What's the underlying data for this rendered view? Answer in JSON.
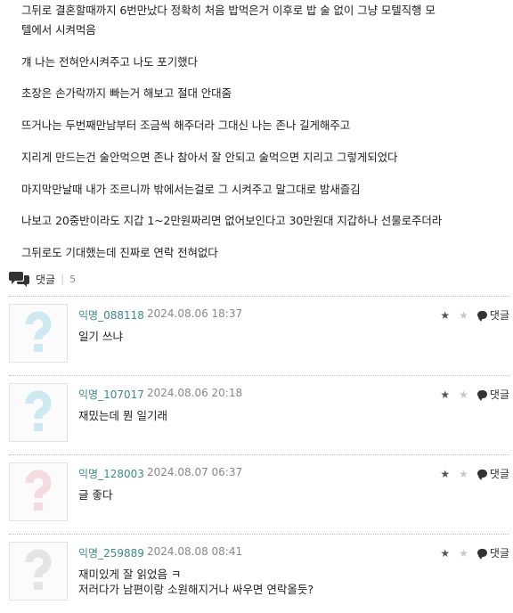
{
  "post": {
    "lines": [
      "그뒤로 결혼할때까지 6번만났다 정확히 처음 밥먹은거 이후로 밥 술 없이 그냥 모텔직행 모",
      "텔에서 시켜먹음",
      "걔 나는 전혀안시켜주고 나도 포기했다",
      "초장은 손가락까지 빠는거 해보고 절대 안대줌",
      "뜨거나는 두번째만남부터 조금씩 해주더라 그대신 나는 존나 길게해주고",
      "지리게 만드는건 술안먹으면 존나 참아서 잘 안되고 술먹으면 지리고 그렇게되었다",
      "마지막만날때 내가 조르니까 밖에서는걸로 그 시켜주고 말그대로 밤새즐김",
      "나보고 20중반이라도 지갑 1~2만원짜리면 없어보인다고 30만원대 지갑하나 선물로주더라",
      "그뒤로도 기대했는데 진짜로 연락 전혀없다"
    ]
  },
  "comment_bar": {
    "icon": "speech-bubbles-icon",
    "label": "댓글",
    "count": "5"
  },
  "comments": [
    {
      "author": "익명_088118",
      "date": "2024.08.06 18:37",
      "text_lines": [
        "일기 쓰냐"
      ],
      "avatar_color": "#cfe9f2",
      "reply_label": "댓글"
    },
    {
      "author": "익명_107017",
      "date": "2024.08.06 20:18",
      "text_lines": [
        "재밌는데 뭔 일기래"
      ],
      "avatar_color": "#cfe9f2",
      "reply_label": "댓글"
    },
    {
      "author": "익명_128003",
      "date": "2024.08.07 06:37",
      "text_lines": [
        "글 좋다"
      ],
      "avatar_color": "#f3dbe0",
      "reply_label": "댓글"
    },
    {
      "author": "익명_259889",
      "date": "2024.08.08 08:41",
      "text_lines": [
        "재미있게 잘 읽었음 ㅋ",
        "저러다가 남편이랑 소원해지거나 싸우면 연락올듯?"
      ],
      "avatar_color": "#e4e4e4",
      "reply_label": "댓글"
    }
  ],
  "colors": {
    "author": "#3c8a8a",
    "date": "#888888",
    "star_filled": "#555555",
    "star_empty": "#c8c8c8"
  }
}
